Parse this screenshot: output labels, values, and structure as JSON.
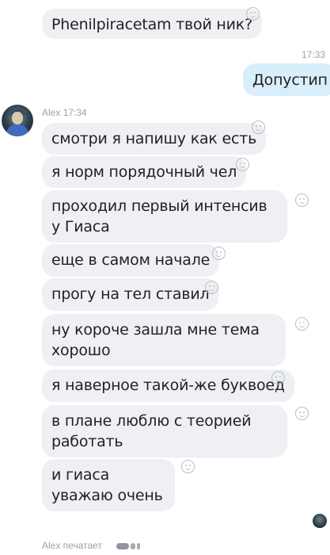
{
  "messages": [
    {
      "text": "Phenilpiracetam твой ник?",
      "own": false
    },
    {
      "text": "Допустип",
      "own": true
    },
    {
      "text": "смотри я напишу как есть",
      "own": false
    },
    {
      "text": "я норм порядочный чел",
      "own": false
    },
    {
      "text": "проходил первый интенсив у Гиаса",
      "own": false
    },
    {
      "text": "еще в самом начале",
      "own": false
    },
    {
      "text": "прогу на тел ставил",
      "own": false
    },
    {
      "text": "ну короче зашла мне тема хорошо",
      "own": false
    },
    {
      "text": "я наверное такой-же буквоед",
      "own": false
    },
    {
      "text": "в плане люблю с теорией работать",
      "own": false
    },
    {
      "text": "и гиаса уважаю очень",
      "own": false
    }
  ],
  "own_time": "17:33",
  "sender": {
    "name": "Alex",
    "time": "17:34"
  },
  "typing": {
    "text": "Alex печатает"
  },
  "icons": {
    "reaction": "smile-reaction-icon",
    "avatar": "user-avatar",
    "typing": "typing-dots-icon"
  },
  "colors": {
    "incoming_bubble": "#eef0f3",
    "outgoing_bubble": "#d9eefb",
    "meta_text": "#99a1ab"
  }
}
